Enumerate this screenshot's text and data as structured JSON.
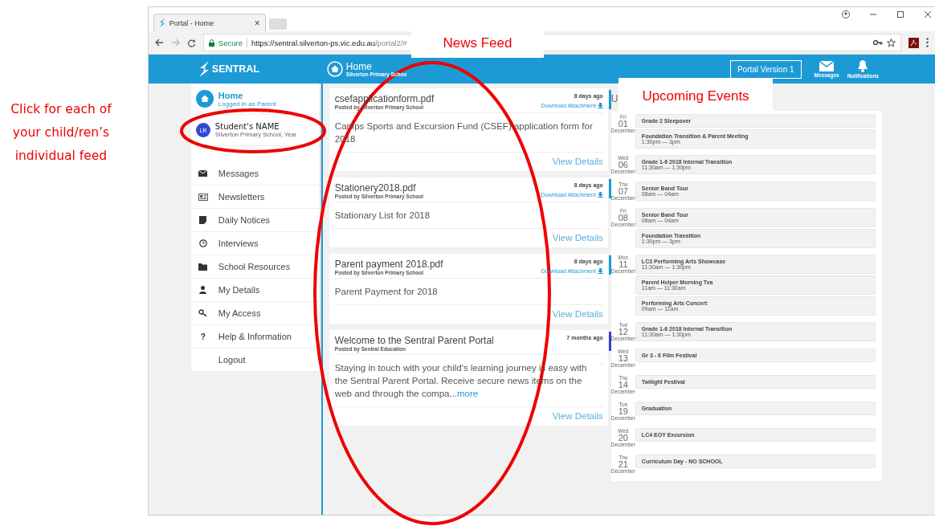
{
  "annotations": {
    "side_note": "Click for each of your child/ren’s individual feed",
    "news_label": "News Feed",
    "events_label": "Upcoming Events"
  },
  "browser": {
    "tab_title": "Portal - Home",
    "tab_close": "×",
    "secure": "Secure",
    "url_host": "https://sentral.silverton-ps.vic.edu.au",
    "url_path": "/portal2/#"
  },
  "header": {
    "brand": "SENTRAL",
    "page_title": "Home",
    "page_subtitle": "Silverton Primary Schoo",
    "version_button": "Portal Version 1",
    "actions": [
      {
        "kind": "mail",
        "label": "Messages"
      },
      {
        "kind": "bell",
        "label": "Notifications"
      }
    ]
  },
  "sidebar": {
    "home": {
      "title": "Home",
      "subtitle": "Logged in as Parent",
      "selected": true
    },
    "student": {
      "initials": "LR",
      "name": "Student's NAME",
      "school": "Silverton Primary School, Year",
      "selected": false
    },
    "items": [
      {
        "kind": "mail",
        "label": "Messages"
      },
      {
        "kind": "news",
        "label": "Newsletters"
      },
      {
        "kind": "note",
        "label": "Daily Notices"
      },
      {
        "kind": "clock",
        "label": "Interviews"
      },
      {
        "kind": "folder",
        "label": "School Resources"
      },
      {
        "kind": "person",
        "label": "My Details"
      },
      {
        "kind": "key",
        "label": "My Access"
      },
      {
        "kind": "help",
        "glyph": "?",
        "label": "Help & Information"
      },
      {
        "kind": "none",
        "label": "Logout"
      }
    ]
  },
  "feed": [
    {
      "title": "csefapplicationform.pdf",
      "age": "8 days ago",
      "posted_by": "Posted by Silverton Primary School",
      "attachment": "Download Attachment",
      "body": "Camps Sports and Excursion Fund (CSEF) application form for 2018",
      "details": "View Details",
      "color": "#1c9ad6",
      "expandable": false
    },
    {
      "title": "Stationery2018.pdf",
      "age": "8 days ago",
      "posted_by": "Posted by Silverton Primary School",
      "attachment": "Download Attachment",
      "body": "Stationary List for 2018",
      "details": "View Details",
      "color": "#1c9ad6",
      "expandable": false
    },
    {
      "title": "Parent payment 2018.pdf",
      "age": "8 days ago",
      "posted_by": "Posted by Silverton Primary School",
      "attachment": "Download Attachment",
      "body": "Parent Payment for 2018",
      "details": "View Details",
      "color": "#1c9ad6",
      "expandable": false
    },
    {
      "title": "Welcome to the Sentral Parent Portal",
      "age": "7 months ago",
      "posted_by": "Posted by Sentral Education",
      "body": "Staying in touch with your child's learning journey is easy with the Sentral Parent Portal. Receive secure news items on the web and through the compa...",
      "more": "more",
      "details": "View Details",
      "color": "#3340d0",
      "expandable": true
    }
  ],
  "events": {
    "heading": "U",
    "days": [
      {
        "dow": "Fri",
        "day": "01",
        "month": "December",
        "items": [
          {
            "title": "Grade 2 Sleepover"
          },
          {
            "title": "Foundation Transition & Parent Meeting",
            "time": "1:30pm — 3pm"
          }
        ]
      },
      {
        "dow": "Wed",
        "day": "06",
        "month": "December",
        "items": [
          {
            "title": "Grade 1-6 2018 Internal Transition",
            "time": "11:30am — 1:30pm"
          }
        ]
      },
      {
        "dow": "Thu",
        "day": "07",
        "month": "December",
        "items": [
          {
            "title": "Senior Band Tour",
            "time": "08am — 04am"
          }
        ]
      },
      {
        "dow": "Fri",
        "day": "08",
        "month": "December",
        "items": [
          {
            "title": "Senior Band Tour",
            "time": "08am — 04am"
          },
          {
            "title": "Foundation Transition",
            "time": "1:30pm — 3pm"
          }
        ]
      },
      {
        "dow": "Mon",
        "day": "11",
        "month": "December",
        "items": [
          {
            "title": "LC3 Performing Arts Showcase",
            "time": "11:30am — 1:30pm"
          },
          {
            "title": "Parent Helper Morning Tea",
            "time": "11am — 11:30am"
          },
          {
            "title": "Performing Arts Concert",
            "time": "09am — 11am"
          }
        ]
      },
      {
        "dow": "Tue",
        "day": "12",
        "month": "December",
        "items": [
          {
            "title": "Grade 1-6 2018 Internal Transition",
            "time": "11:30am — 1:30pm"
          }
        ]
      },
      {
        "dow": "Wed",
        "day": "13",
        "month": "December",
        "items": [
          {
            "title": "Gr 3 - 6 Film Festival"
          }
        ]
      },
      {
        "dow": "Thu",
        "day": "14",
        "month": "December",
        "items": [
          {
            "title": "Twilight Festival"
          }
        ]
      },
      {
        "dow": "Tue",
        "day": "19",
        "month": "December",
        "items": [
          {
            "title": "Graduation"
          }
        ]
      },
      {
        "dow": "Wed",
        "day": "20",
        "month": "December",
        "items": [
          {
            "title": "LC4 EOY Excursion"
          }
        ]
      },
      {
        "dow": "Thu",
        "day": "21",
        "month": "December",
        "items": [
          {
            "title": "Curriculum Day - NO SCHOOL"
          }
        ]
      }
    ]
  }
}
